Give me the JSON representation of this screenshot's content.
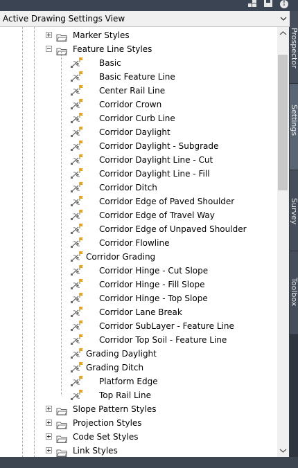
{
  "header": {
    "icons": [
      "window-layout-icon",
      "save-icon",
      "info-icon"
    ]
  },
  "view_select": {
    "label": "Active Drawing Settings View"
  },
  "side_tabs": [
    {
      "label": "Prospector"
    },
    {
      "label": "Settings"
    },
    {
      "label": "Survey"
    },
    {
      "label": "Toolbox"
    }
  ],
  "tree": {
    "marker_styles": "Marker Styles",
    "feature_line_styles": "Feature Line Styles",
    "children": [
      {
        "label": "Basic",
        "level": 2
      },
      {
        "label": "Basic Feature Line",
        "level": 2
      },
      {
        "label": "Center Rail Line",
        "level": 2
      },
      {
        "label": "Corridor Crown",
        "level": 2
      },
      {
        "label": "Corridor Curb Line",
        "level": 2
      },
      {
        "label": "Corridor Daylight",
        "level": 2
      },
      {
        "label": "Corridor Daylight - Subgrade",
        "level": 2
      },
      {
        "label": "Corridor Daylight Line - Cut",
        "level": 2
      },
      {
        "label": "Corridor Daylight Line - Fill",
        "level": 2
      },
      {
        "label": "Corridor Ditch",
        "level": 2
      },
      {
        "label": "Corridor Edge of Paved Shoulder",
        "level": 2
      },
      {
        "label": "Corridor Edge of Travel Way",
        "level": 2
      },
      {
        "label": "Corridor Edge of Unpaved Shoulder",
        "level": 2
      },
      {
        "label": "Corridor Flowline",
        "level": 2
      },
      {
        "label": "Corridor Grading",
        "level": 1
      },
      {
        "label": "Corridor Hinge - Cut Slope",
        "level": 2
      },
      {
        "label": "Corridor Hinge - Fill Slope",
        "level": 2
      },
      {
        "label": "Corridor Hinge - Top Slope",
        "level": 2
      },
      {
        "label": "Corridor Lane Break",
        "level": 2
      },
      {
        "label": "Corridor SubLayer - Feature Line",
        "level": 2
      },
      {
        "label": "Corridor Top Soil - Feature Line",
        "level": 2
      },
      {
        "label": "Grading Daylight",
        "level": 1
      },
      {
        "label": "Grading Ditch",
        "level": 1
      },
      {
        "label": "Platform Edge",
        "level": 2
      },
      {
        "label": "Top Rail Line",
        "level": 2
      }
    ],
    "after": [
      {
        "label": "Slope Pattern Styles"
      },
      {
        "label": "Projection Styles"
      },
      {
        "label": "Code Set Styles"
      },
      {
        "label": "Link Styles"
      }
    ]
  }
}
